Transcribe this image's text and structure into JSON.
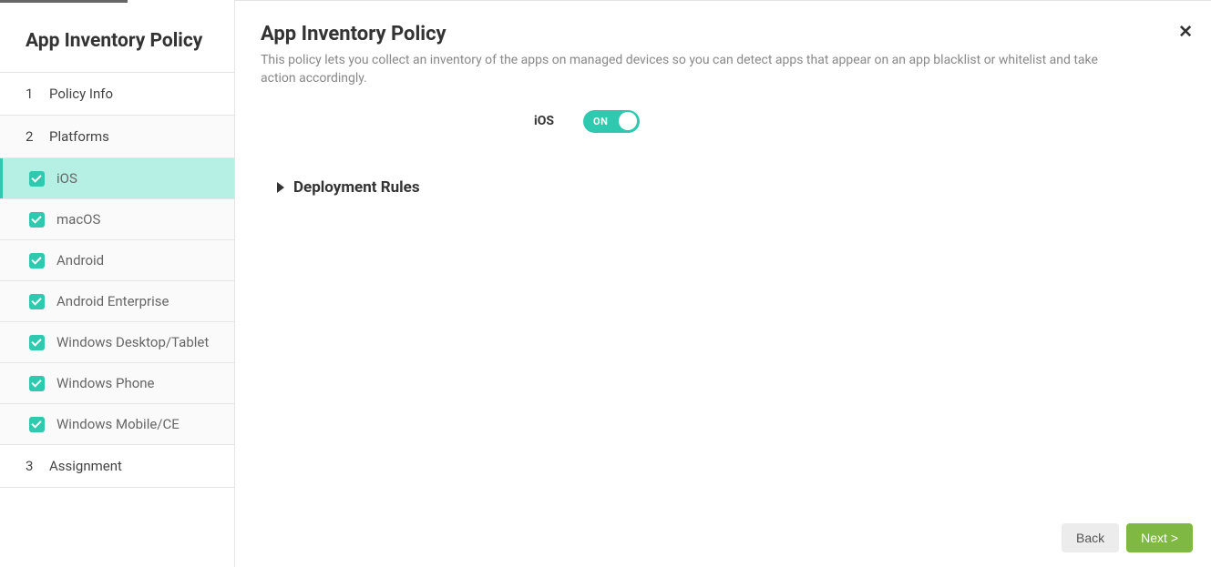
{
  "sidebar": {
    "title": "App Inventory Policy",
    "steps": [
      {
        "num": "1",
        "label": "Policy Info"
      },
      {
        "num": "2",
        "label": "Platforms"
      },
      {
        "num": "3",
        "label": "Assignment"
      }
    ],
    "platforms": [
      {
        "label": "iOS"
      },
      {
        "label": "macOS"
      },
      {
        "label": "Android"
      },
      {
        "label": "Android Enterprise"
      },
      {
        "label": "Windows Desktop/Tablet"
      },
      {
        "label": "Windows Phone"
      },
      {
        "label": "Windows Mobile/CE"
      }
    ]
  },
  "main": {
    "title": "App Inventory Policy",
    "description": "This policy lets you collect an inventory of the apps on managed devices so you can detect apps that appear on an app blacklist or whitelist and take action accordingly.",
    "toggle": {
      "label": "iOS",
      "state": "ON"
    },
    "section": "Deployment Rules"
  },
  "footer": {
    "back": "Back",
    "next": "Next >"
  }
}
